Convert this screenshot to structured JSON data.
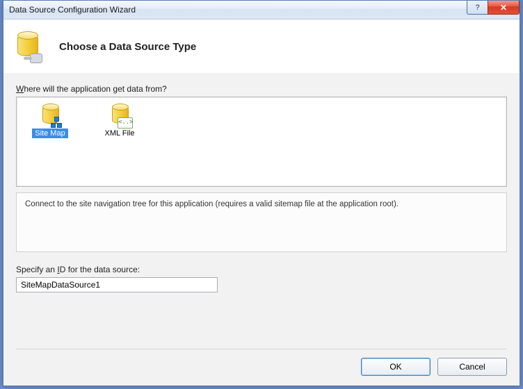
{
  "window": {
    "title": "Data Source Configuration Wizard"
  },
  "header": {
    "heading": "Choose a Data Source Type"
  },
  "question": {
    "prefix_underlined": "W",
    "rest": "here will the application get data from?"
  },
  "sources": [
    {
      "label": "Site Map",
      "selected": true
    },
    {
      "label": "XML File",
      "selected": false
    }
  ],
  "description": "Connect to the site navigation tree for this application (requires a valid sitemap file at the application root).",
  "id_section": {
    "prefix": "Specify an ",
    "underlined": "I",
    "suffix": "D for the data source:",
    "value": "SiteMapDataSource1"
  },
  "buttons": {
    "ok": "OK",
    "cancel": "Cancel"
  },
  "xml_glyph": "<..>"
}
